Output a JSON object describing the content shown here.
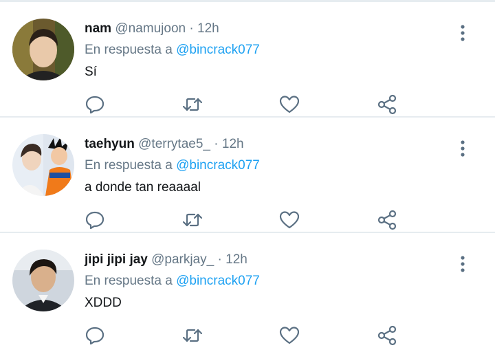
{
  "tweets": [
    {
      "name": "nam",
      "handle": "@namujoon",
      "sep": " · ",
      "time": "12h",
      "reply_prefix": "En respuesta a ",
      "reply_to": "@bincrack077",
      "text": "Sí",
      "avatar": "avatar-nam"
    },
    {
      "name": "taehyun",
      "handle": "@terrytae5_",
      "sep": " · ",
      "time": "12h",
      "reply_prefix": "En respuesta a ",
      "reply_to": "@bincrack077",
      "text": "a donde tan reaaaal",
      "avatar": "avatar-taehyun"
    },
    {
      "name": "jipi jipi jay",
      "handle": "@parkjay_",
      "sep": " · ",
      "time": "12h",
      "reply_prefix": "En respuesta a ",
      "reply_to": "@bincrack077",
      "text": "XDDD",
      "avatar": "avatar-jipi"
    }
  ],
  "icons": {
    "reply": "reply-icon",
    "retweet": "retweet-icon",
    "like": "heart-icon",
    "share": "share-icon",
    "more": "more-vertical-icon"
  },
  "colors": {
    "name": "#14171a",
    "secondary": "#657786",
    "mention": "#1da1f2",
    "icon": "#5b7083",
    "divider": "#e6ecf0"
  }
}
